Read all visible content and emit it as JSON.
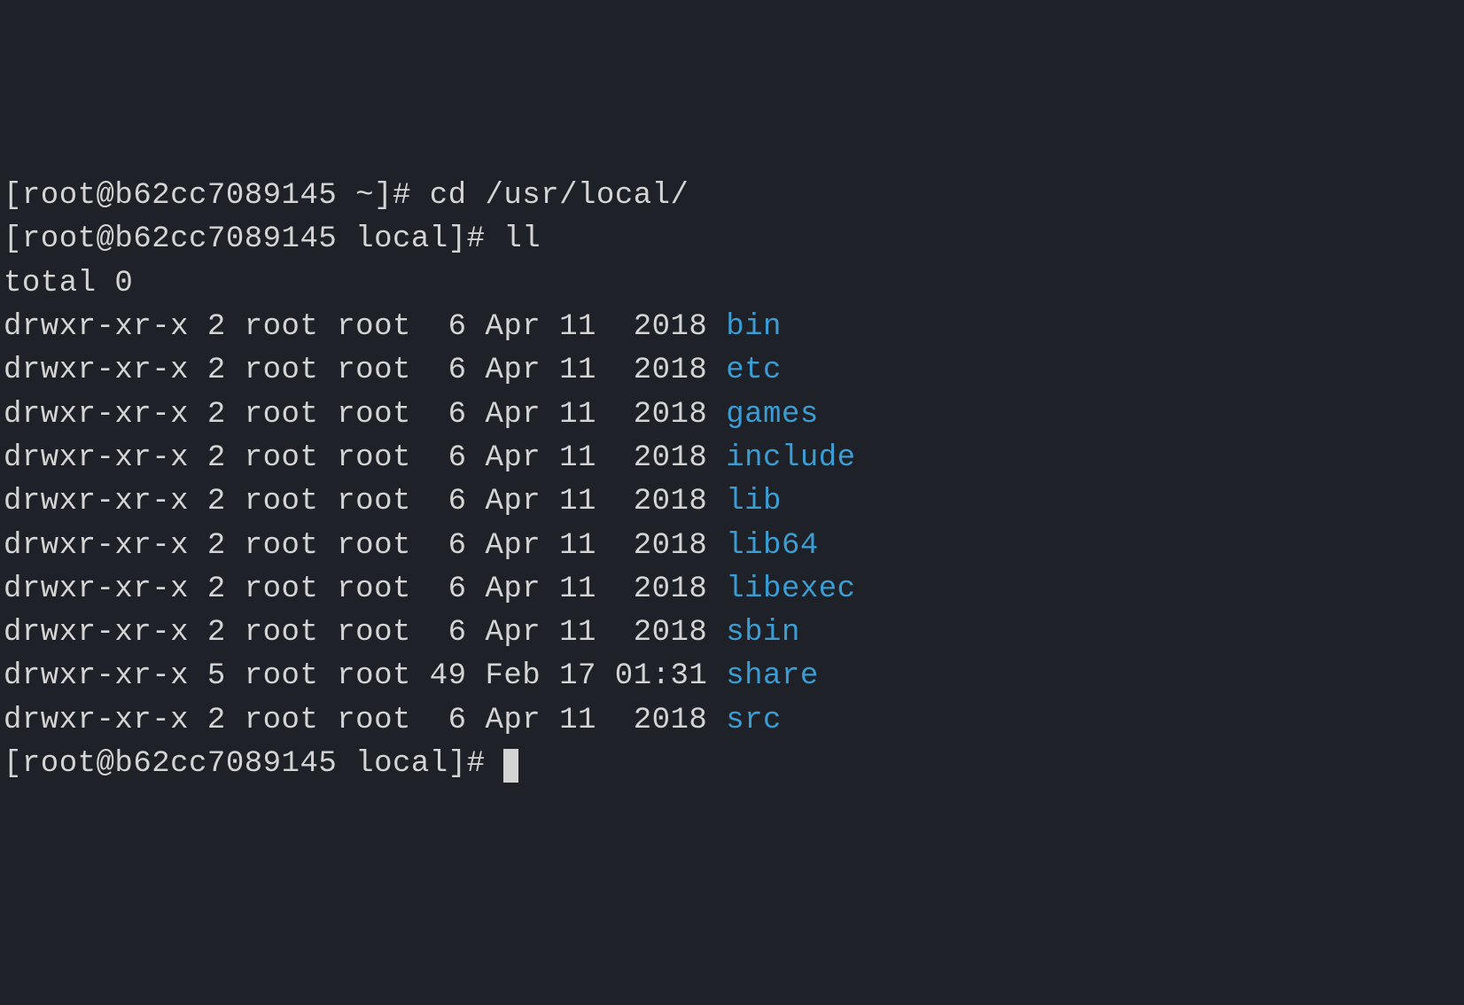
{
  "truncated_top": "[root@b62cc7089145 ~]# ",
  "prompts": {
    "p1": "[root@b62cc7089145 ~]# ",
    "p2": "[root@b62cc7089145 local]# ",
    "p3": "[root@b62cc7089145 local]# "
  },
  "commands": {
    "cmd1": "cd /usr/local/",
    "cmd2": "ll"
  },
  "output": {
    "total": "total 0",
    "rows": [
      {
        "perms": "drwxr-xr-x",
        "links": "2",
        "owner": "root",
        "group": "root",
        "size": " 6",
        "month": "Apr",
        "day": "11",
        "time": " 2018",
        "name": "bin"
      },
      {
        "perms": "drwxr-xr-x",
        "links": "2",
        "owner": "root",
        "group": "root",
        "size": " 6",
        "month": "Apr",
        "day": "11",
        "time": " 2018",
        "name": "etc"
      },
      {
        "perms": "drwxr-xr-x",
        "links": "2",
        "owner": "root",
        "group": "root",
        "size": " 6",
        "month": "Apr",
        "day": "11",
        "time": " 2018",
        "name": "games"
      },
      {
        "perms": "drwxr-xr-x",
        "links": "2",
        "owner": "root",
        "group": "root",
        "size": " 6",
        "month": "Apr",
        "day": "11",
        "time": " 2018",
        "name": "include"
      },
      {
        "perms": "drwxr-xr-x",
        "links": "2",
        "owner": "root",
        "group": "root",
        "size": " 6",
        "month": "Apr",
        "day": "11",
        "time": " 2018",
        "name": "lib"
      },
      {
        "perms": "drwxr-xr-x",
        "links": "2",
        "owner": "root",
        "group": "root",
        "size": " 6",
        "month": "Apr",
        "day": "11",
        "time": " 2018",
        "name": "lib64"
      },
      {
        "perms": "drwxr-xr-x",
        "links": "2",
        "owner": "root",
        "group": "root",
        "size": " 6",
        "month": "Apr",
        "day": "11",
        "time": " 2018",
        "name": "libexec"
      },
      {
        "perms": "drwxr-xr-x",
        "links": "2",
        "owner": "root",
        "group": "root",
        "size": " 6",
        "month": "Apr",
        "day": "11",
        "time": " 2018",
        "name": "sbin"
      },
      {
        "perms": "drwxr-xr-x",
        "links": "5",
        "owner": "root",
        "group": "root",
        "size": "49",
        "month": "Feb",
        "day": "17",
        "time": "01:31",
        "name": "share"
      },
      {
        "perms": "drwxr-xr-x",
        "links": "2",
        "owner": "root",
        "group": "root",
        "size": " 6",
        "month": "Apr",
        "day": "11",
        "time": " 2018",
        "name": "src"
      }
    ]
  }
}
